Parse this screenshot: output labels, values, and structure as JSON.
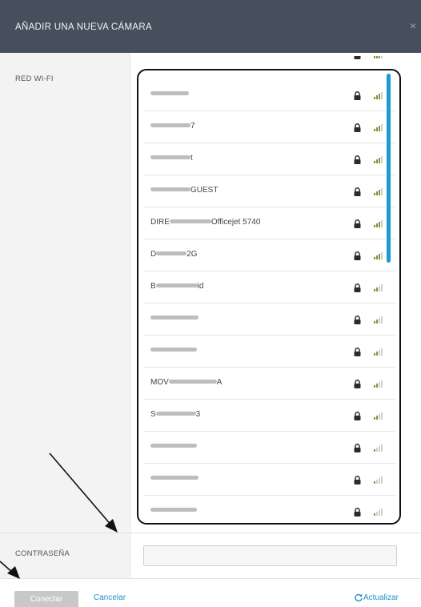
{
  "dialog": {
    "title": "AÑADIR UNA NUEVA CÁMARA",
    "close_icon": "×"
  },
  "wifi": {
    "label": "RED WI-FI",
    "networks": [
      {
        "name": "",
        "blur": 58,
        "secured": true,
        "signal": "medium"
      },
      {
        "name": "",
        "blur": 48,
        "secured": true,
        "signal": "medium"
      },
      {
        "name": "",
        "blur": 50,
        "suffix": "7",
        "secured": true,
        "signal": "medium"
      },
      {
        "name": "",
        "blur": 50,
        "suffix": "t",
        "secured": true,
        "signal": "medium"
      },
      {
        "prefix": "",
        "blur": 50,
        "suffix": "GUEST",
        "secured": true,
        "signal": "medium"
      },
      {
        "prefix": "DIRE",
        "blur": 52,
        "suffix": "Officejet 5740",
        "secured": true,
        "signal": "medium"
      },
      {
        "prefix": "D",
        "blur": 38,
        "suffix": "2G",
        "secured": true,
        "signal": "medium"
      },
      {
        "prefix": "B",
        "blur": 52,
        "suffix": "id",
        "secured": true,
        "signal": "low"
      },
      {
        "name": "",
        "blur": 60,
        "secured": true,
        "signal": "low"
      },
      {
        "name": "",
        "blur": 58,
        "secured": true,
        "signal": "low"
      },
      {
        "prefix": "MOV",
        "blur": 60,
        "suffix": "A",
        "secured": true,
        "signal": "low"
      },
      {
        "prefix": "S",
        "blur": 50,
        "suffix": "3",
        "secured": true,
        "signal": "low"
      },
      {
        "name": "",
        "blur": 58,
        "secured": true,
        "signal": "weak"
      },
      {
        "name": "",
        "blur": 60,
        "secured": true,
        "signal": "weak"
      },
      {
        "name": "",
        "blur": 58,
        "secured": true,
        "signal": "weak"
      }
    ]
  },
  "password": {
    "label": "CONTRASEÑA",
    "value": "",
    "placeholder": ""
  },
  "footer": {
    "connect_label": "Conectar",
    "cancel_label": "Cancelar",
    "refresh_label": "Actualizar"
  },
  "colors": {
    "header": "#46505c",
    "accent": "#1e8fc6",
    "scrollbar": "#1a9bd2"
  }
}
